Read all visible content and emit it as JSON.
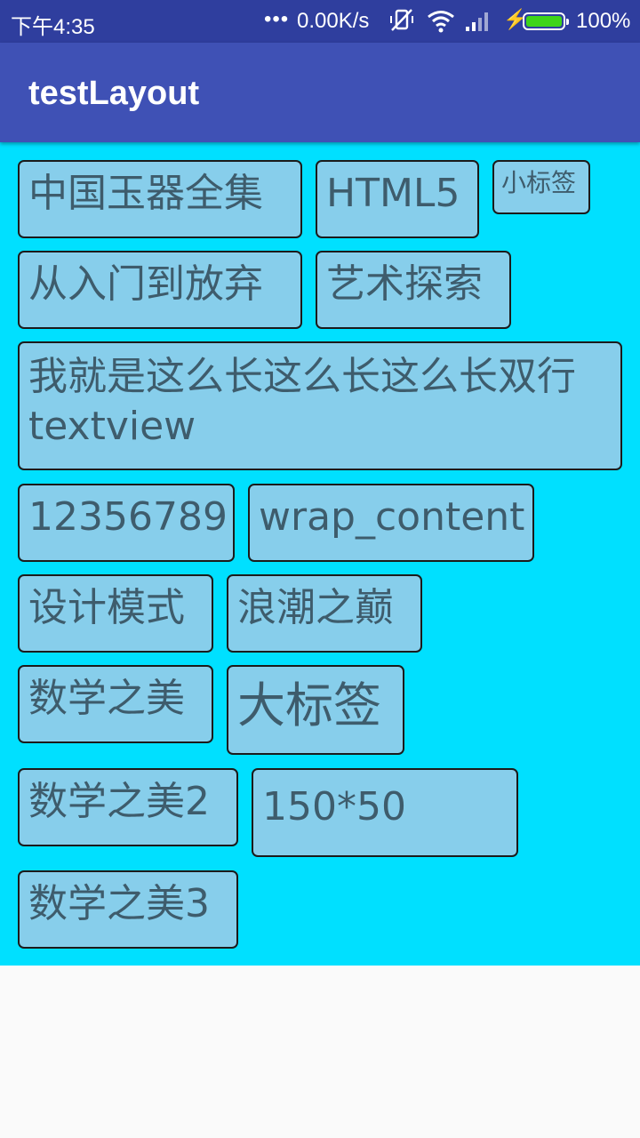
{
  "status_bar": {
    "time": "下午4:35",
    "dots_icon": "more-dots-icon",
    "net_speed": "0.00K/s",
    "mute_icon": "vibrate-off-icon",
    "wifi_icon": "wifi-icon",
    "signal_icon": "cell-signal-icon",
    "charging_icon": "charging-bolt-icon",
    "battery_icon": "battery-icon",
    "battery_percent": "100%",
    "battery_color": "#3ed41a"
  },
  "app_bar": {
    "title": "testLayout",
    "color": "#3f51b5"
  },
  "content": {
    "background_color": "#00e0ff",
    "tag_color": "#87ceeb",
    "tags": [
      {
        "label": "中国玉器全集"
      },
      {
        "label": "HTML5"
      },
      {
        "label": "小标签"
      },
      {
        "label": "从入门到放弃"
      },
      {
        "label": "艺术探索"
      },
      {
        "label": "我就是这么长这么长这么长双行textview"
      },
      {
        "label": "12356789"
      },
      {
        "label": "wrap_content"
      },
      {
        "label": "设计模式"
      },
      {
        "label": "浪潮之巅"
      },
      {
        "label": "数学之美"
      },
      {
        "label": "大标签"
      },
      {
        "label": "数学之美2"
      },
      {
        "label": "150*50"
      },
      {
        "label": "数学之美3"
      }
    ]
  }
}
